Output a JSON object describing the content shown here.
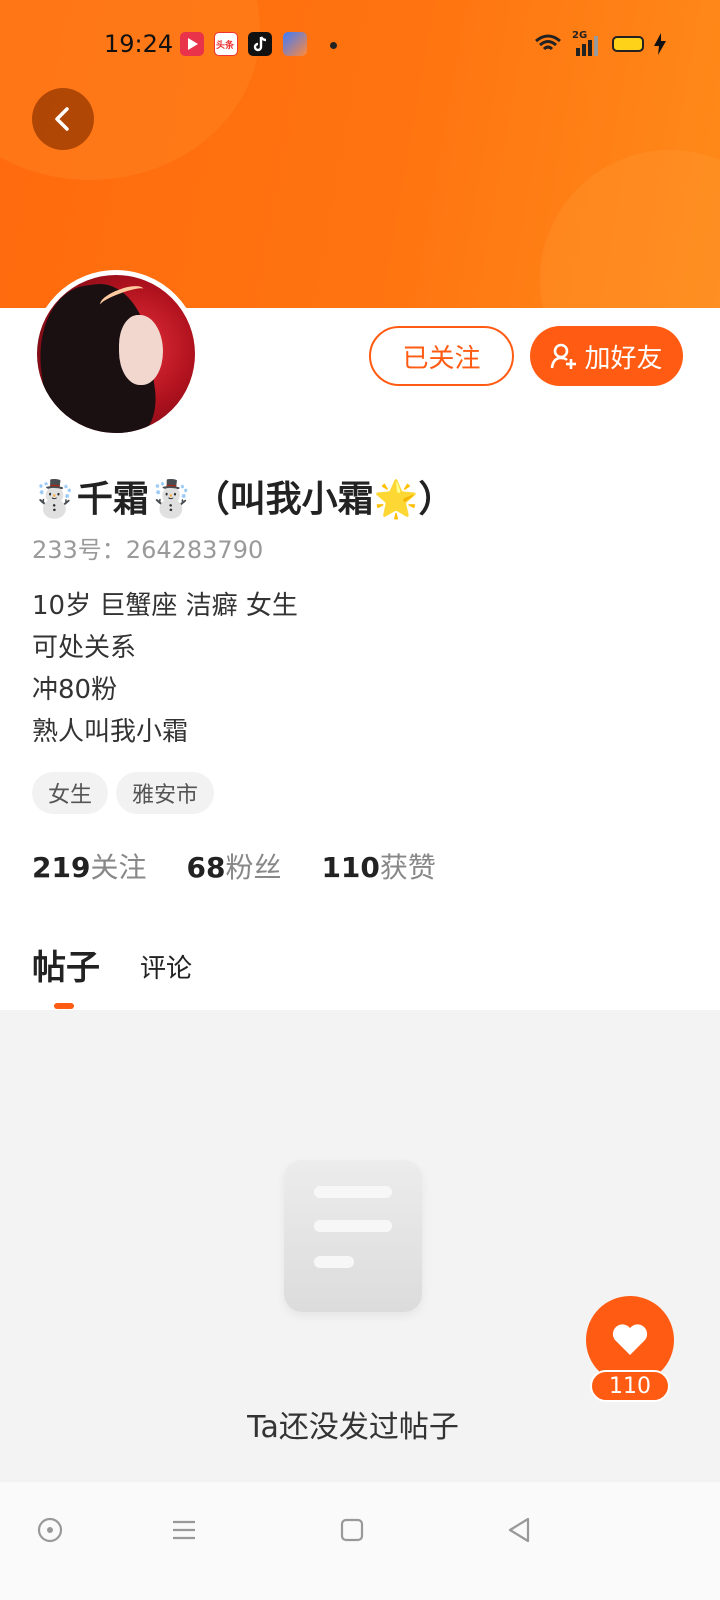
{
  "status_bar": {
    "time": "19:24",
    "apps": [
      "video-app-icon",
      "toutiao-app-icon",
      "tiktok-app-icon",
      "assistant-app-icon"
    ],
    "app_labels": {
      "toutiao": "头条"
    },
    "network": "2G",
    "icons": [
      "wifi-icon",
      "signal-icon",
      "battery-icon",
      "charging-icon"
    ]
  },
  "profile": {
    "name": "☃️千霜☃️（叫我小霜🌟）",
    "id_label": "233号：264283790",
    "bio": [
      "10岁 巨蟹座 洁癖 女生",
      "可处关系",
      "冲80粉",
      "熟人叫我小霜"
    ],
    "tags": [
      "女生",
      "雅安市"
    ]
  },
  "actions": {
    "following_label": "已关注",
    "add_friend_label": "加好友"
  },
  "stats": [
    {
      "value": "219",
      "label": "关注"
    },
    {
      "value": "68",
      "label": "粉丝"
    },
    {
      "value": "110",
      "label": "获赞"
    }
  ],
  "tabs": {
    "posts": "帖子",
    "comments": "评论"
  },
  "empty_state": {
    "text": "Ta还没发过帖子"
  },
  "like_fab": {
    "count": "110"
  },
  "colors": {
    "accent": "#ff5b12",
    "banner": "#ff7410"
  }
}
